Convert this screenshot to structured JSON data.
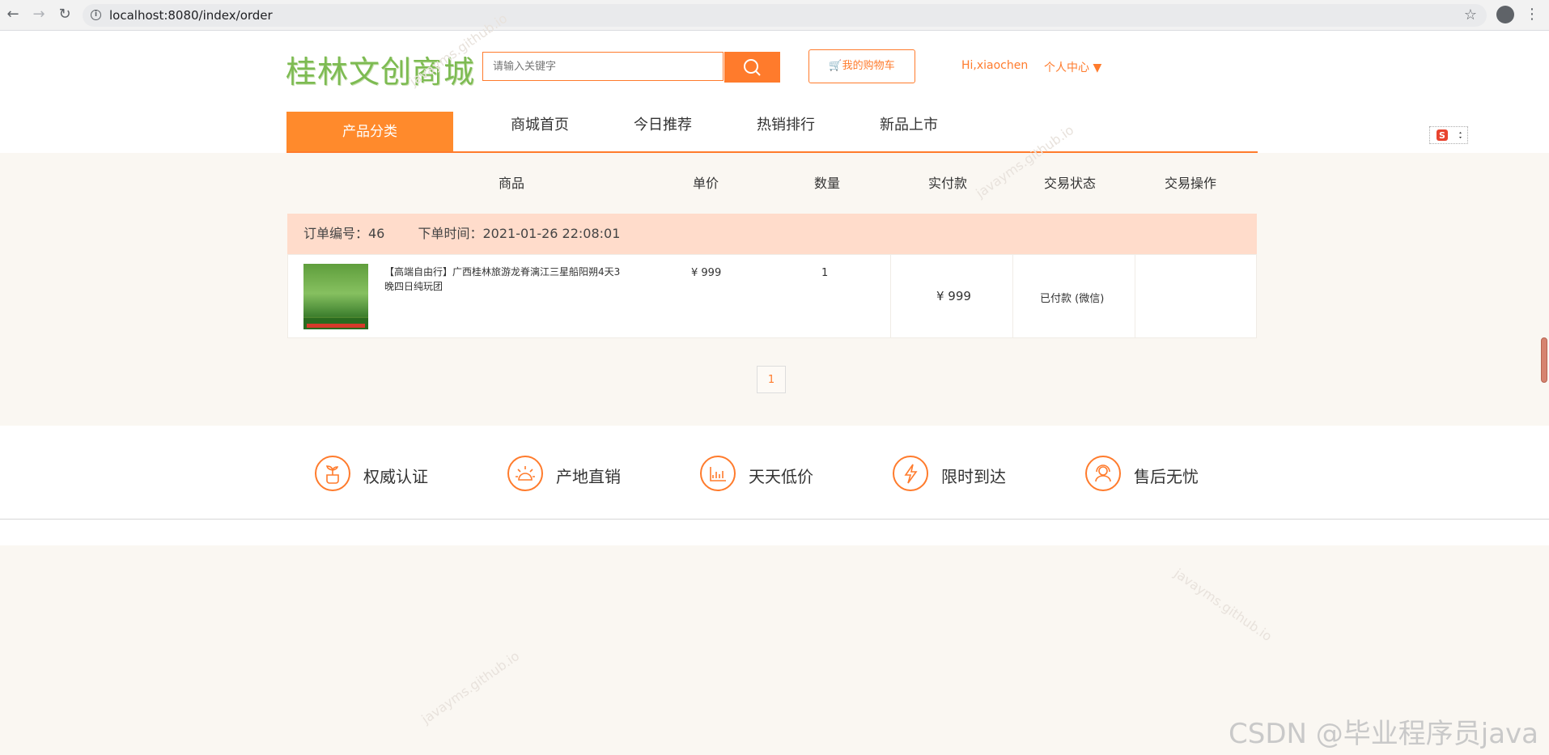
{
  "browser": {
    "url": "localhost:8080/index/order",
    "icons": [
      "back-icon",
      "forward-icon",
      "reload-icon",
      "info-icon",
      "star-icon",
      "profile-icon",
      "menu-icon"
    ]
  },
  "header": {
    "logo": "桂林文创商城",
    "search_placeholder": "请输入关键字",
    "cart_label": "🛒我的购物车",
    "user_greeting": "Hi,xiaochen",
    "personal_center": "个人中心 ▼"
  },
  "nav": {
    "category": "产品分类",
    "items": [
      "商城首页",
      "今日推荐",
      "热销排行",
      "新品上市"
    ]
  },
  "table": {
    "headers": [
      "商品",
      "单价",
      "数量",
      "实付款",
      "交易状态",
      "交易操作"
    ]
  },
  "orders": [
    {
      "order_no_label": "订单编号：46",
      "order_time_label": "下单时间：2021-01-26 22:08:01",
      "product_title": "【高端自由行】广西桂林旅游龙脊漓江三星船阳朔4天3晚四日纯玩团",
      "unit_price": "¥ 999",
      "quantity": "1",
      "paid": "¥ 999",
      "status": "已付款 (微信)",
      "operation": ""
    }
  ],
  "pagination": {
    "current": "1"
  },
  "features": [
    {
      "label": "权威认证",
      "icon": "plant-icon"
    },
    {
      "label": "产地直销",
      "icon": "sun-icon"
    },
    {
      "label": "天天低价",
      "icon": "chart-icon"
    },
    {
      "label": "限时到达",
      "icon": "lightning-icon"
    },
    {
      "label": "售后无忧",
      "icon": "support-icon"
    }
  ],
  "watermarks": [
    "javayms.github.io",
    "javayms.github.io",
    "javayms.github.io",
    "javayms.github.io"
  ],
  "footer_credit": "CSDN @毕业程序员java",
  "colors": {
    "accent": "#ff7b2c",
    "category_bg": "#ff8a2c",
    "order_head_bg": "#ffdccb",
    "page_bg": "#faf7f2"
  }
}
